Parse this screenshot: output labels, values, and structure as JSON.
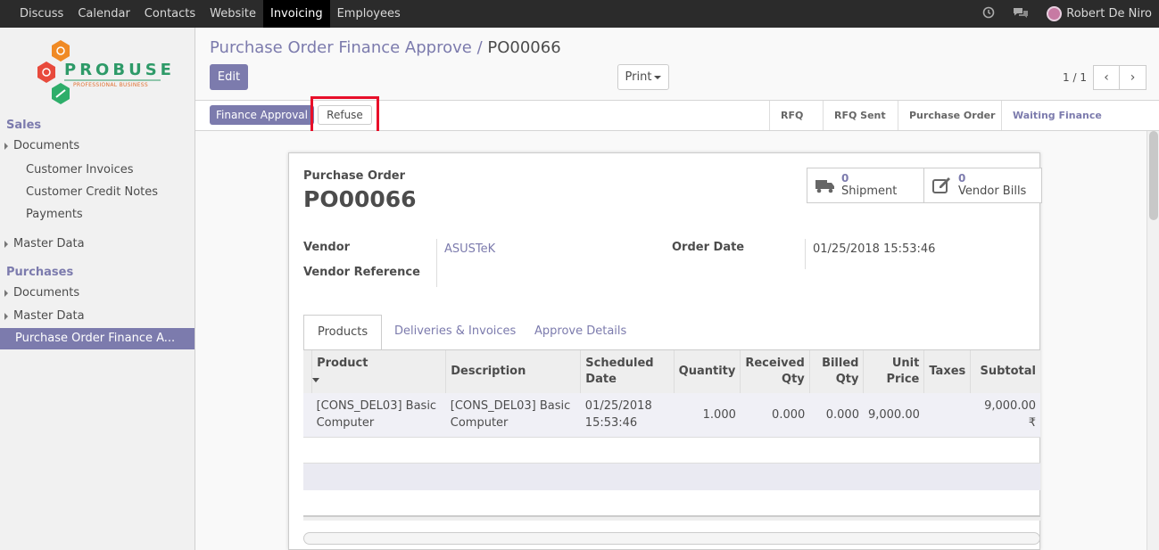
{
  "topbar": {
    "menu": [
      "Discuss",
      "Calendar",
      "Contacts",
      "Website",
      "Invoicing",
      "Employees"
    ],
    "active": "Invoicing",
    "user": "Robert De Niro"
  },
  "logo": {
    "brand": "PROBUSE",
    "tagline": "PROFESSIONAL BUSINESS"
  },
  "sidebar": {
    "sales_title": "Sales",
    "sales_documents": "Documents",
    "customer_invoices": "Customer Invoices",
    "customer_credit_notes": "Customer Credit Notes",
    "payments": "Payments",
    "sales_master_data": "Master Data",
    "purchases_title": "Purchases",
    "purchases_documents": "Documents",
    "purchases_master_data": "Master Data",
    "po_finance": "Purchase Order Finance A..."
  },
  "breadcrumb": {
    "parent": "Purchase Order Finance Approve",
    "sep": "/",
    "current": "PO00066"
  },
  "buttons": {
    "edit": "Edit",
    "print": "Print",
    "finance_approval": "Finance Approval",
    "refuse": "Refuse"
  },
  "pager": {
    "value": "1 / 1"
  },
  "stages": [
    "RFQ",
    "RFQ Sent",
    "Purchase Order",
    "Waiting Finance Approval"
  ],
  "current_stage": "Waiting Finance Approval",
  "form": {
    "doc_type": "Purchase Order",
    "name": "PO00066",
    "shipment_count": "0",
    "shipment_label": "Shipment",
    "bills_count": "0",
    "bills_label": "Vendor Bills",
    "vendor_label": "Vendor",
    "vendor_value": "ASUSTeK",
    "vendor_ref_label": "Vendor Reference",
    "order_date_label": "Order Date",
    "order_date_value": "01/25/2018 15:53:46"
  },
  "tabs": [
    "Products",
    "Deliveries & Invoices",
    "Approve Details"
  ],
  "table": {
    "headers": {
      "product": "Product",
      "description": "Description",
      "scheduled_1": "Scheduled",
      "scheduled_2": "Date",
      "quantity": "Quantity",
      "received_1": "Received",
      "received_2": "Qty",
      "billed_1": "Billed",
      "billed_2": "Qty",
      "unit_1": "Unit",
      "unit_2": "Price",
      "taxes": "Taxes",
      "subtotal": "Subtotal"
    },
    "row": {
      "product_1": "[CONS_DEL03] Basic",
      "product_2": "Computer",
      "description_1": "[CONS_DEL03] Basic",
      "description_2": "Computer",
      "date_1": "01/25/2018",
      "date_2": "15:53:46",
      "quantity": "1.000",
      "received": "0.000",
      "billed": "0.000",
      "unit_price": "9,000.00",
      "taxes": "",
      "subtotal": "9,000.00 ₹"
    }
  },
  "colors": {
    "accent": "#7c7bad",
    "topbar": "#2b2b2b",
    "highlight": "#e8102a"
  }
}
